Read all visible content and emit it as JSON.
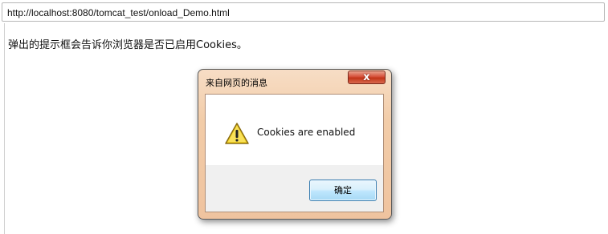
{
  "browser": {
    "address": "http://localhost:8080/tomcat_test/onload_Demo.html"
  },
  "page": {
    "text": "弹出的提示框会告诉你浏览器是否已启用Cookies。"
  },
  "dialog": {
    "title": "来自网页的消息",
    "close_label": "x",
    "message": "Cookies are enabled",
    "ok_label": "确定",
    "icon": "warning-icon"
  }
}
